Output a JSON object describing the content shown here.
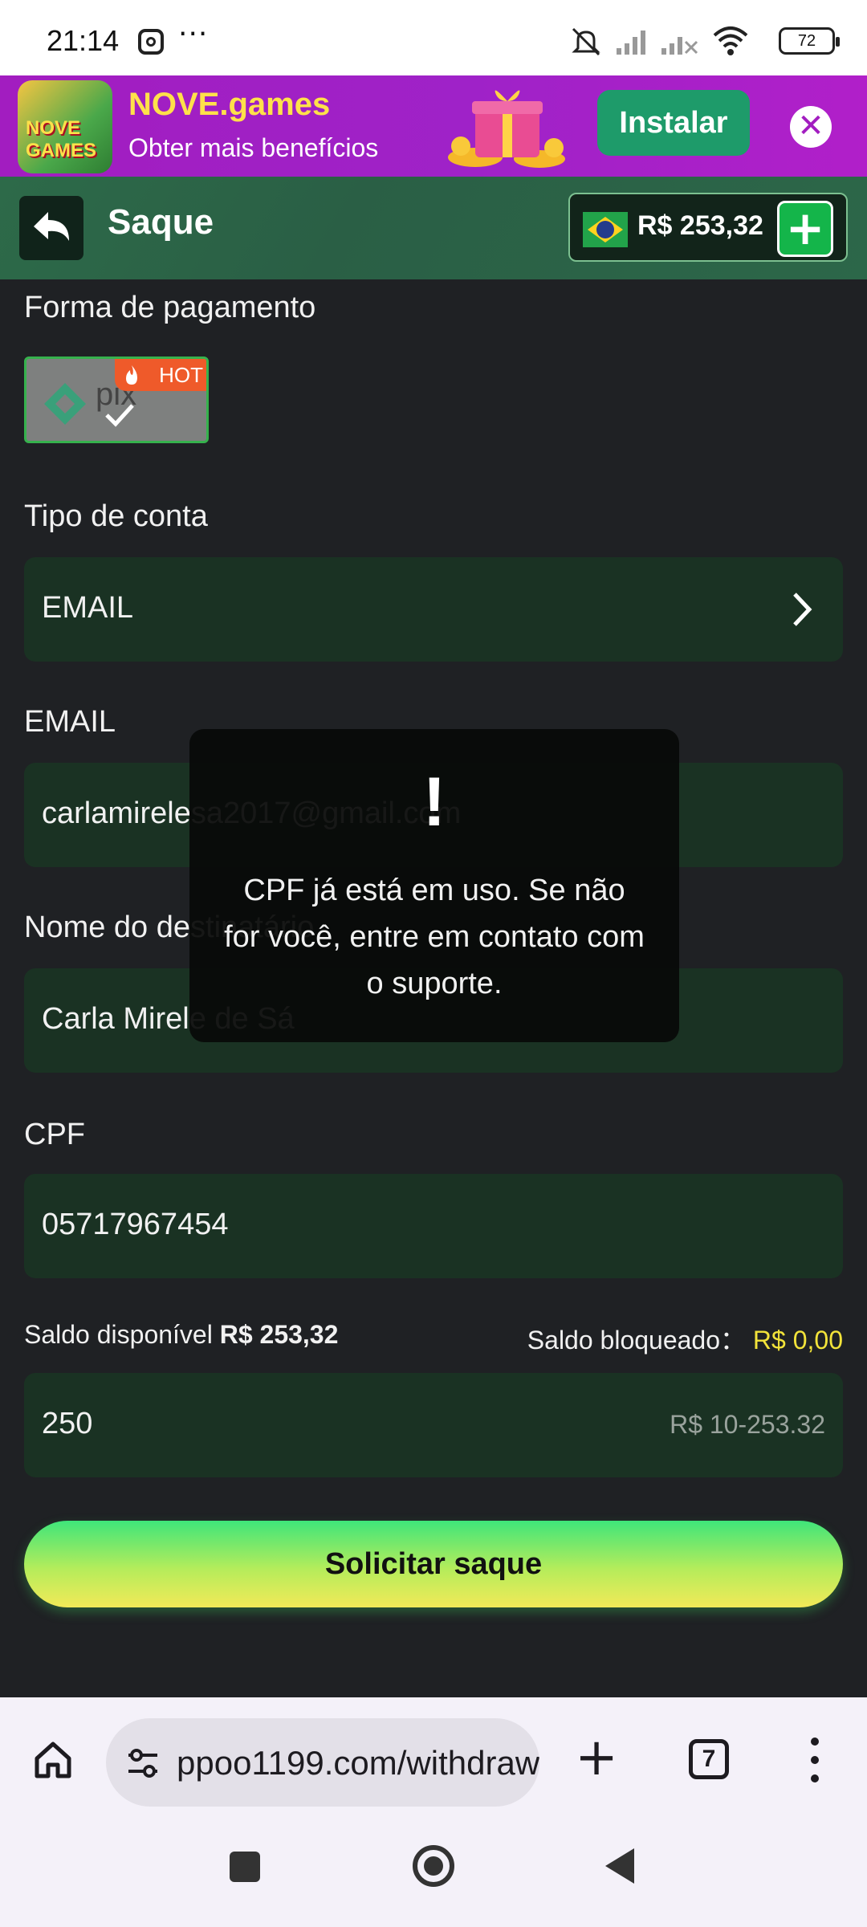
{
  "status_bar": {
    "time": "21:14",
    "more": "···",
    "battery": "72"
  },
  "promo": {
    "logo_text": "NOVE GAMES",
    "title": "NOVE.games",
    "subtitle": "Obter mais benefícios",
    "install_label": "Instalar",
    "close_glyph": "✕"
  },
  "header": {
    "title": "Saque",
    "balance": "R$ 253,32",
    "add_glyph": "+"
  },
  "form": {
    "payment_method_label": "Forma de pagamento",
    "payment_option": {
      "name": "pix",
      "badge": "HOT"
    },
    "account_type_label": "Tipo de conta",
    "account_type_value": "EMAIL",
    "email_label": "EMAIL",
    "email_value": "carlamirelesa2017@gmail.com",
    "recipient_label": "Nome do destinatário",
    "recipient_value": "Carla Mirele de Sá",
    "cpf_label": "CPF",
    "cpf_value": "05717967454",
    "available_label": "Saldo disponível",
    "available_value": "R$ 253,32",
    "blocked_label": "Saldo bloqueado：",
    "blocked_value": "R$ 0,00",
    "amount_value": "250",
    "amount_range": "R$ 10-253.32",
    "submit_label": "Solicitar saque"
  },
  "toast": {
    "icon": "!",
    "message": "CPF já está em uso. Se não for você, entre em contato com o suporte."
  },
  "browser": {
    "url": "ppoo1199.com/withdraw",
    "tab_count": "7",
    "new_tab_glyph": "+"
  },
  "colors": {
    "background": "#1f2124",
    "field": "#1a3223",
    "header": "#2d6a49",
    "accent_green": "#14b54a",
    "blocked_yellow": "#f2e33a",
    "promo_purple": "#a21dc0"
  }
}
